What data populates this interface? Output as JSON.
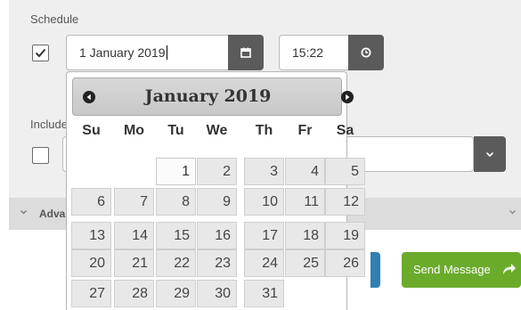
{
  "schedule": {
    "label": "Schedule",
    "checked": true,
    "date_value": "1 January 2019",
    "time_value": "15:22",
    "date_button_icon": "calendar-icon",
    "time_button_icon": "clock-icon"
  },
  "include": {
    "label": "Include",
    "checked": false,
    "select_icon": "chevron-down-icon"
  },
  "advanced": {
    "label": "Advanced"
  },
  "actions": {
    "send_label": "Send Message",
    "send_icon": "share-arrow-icon",
    "send_color": "#6aab2c"
  },
  "datepicker": {
    "title": "January 2019",
    "prev_icon": "circle-triangle-left-icon",
    "next_icon": "circle-triangle-right-icon",
    "weekdays": [
      "Su",
      "Mo",
      "Tu",
      "We",
      "Th",
      "Fr",
      "Sa"
    ],
    "selected_day": "1",
    "weeks": [
      [
        "",
        "",
        "",
        "1",
        "2",
        "3",
        "4",
        "5"
      ],
      [
        "6",
        "7",
        "8",
        "9",
        "10",
        "11",
        "12"
      ],
      [
        "13",
        "14",
        "15",
        "16",
        "17",
        "18",
        "19"
      ],
      [
        "20",
        "21",
        "22",
        "23",
        "24",
        "25",
        "26"
      ],
      [
        "27",
        "28",
        "29",
        "30",
        "31"
      ]
    ]
  }
}
